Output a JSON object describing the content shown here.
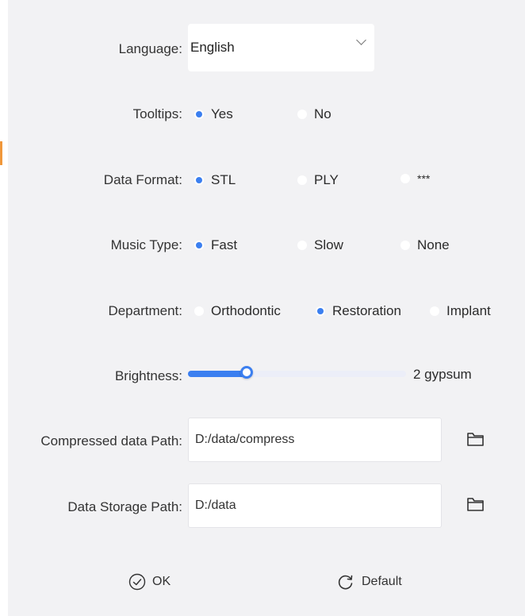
{
  "language": {
    "label": "Language:",
    "value": "English"
  },
  "tooltips": {
    "label": "Tooltips:",
    "options": [
      "Yes",
      "No"
    ],
    "selected": "Yes"
  },
  "data_format": {
    "label": "Data Format:",
    "options": [
      "STL",
      "PLY",
      "***"
    ],
    "selected": "STL"
  },
  "music_type": {
    "label": "Music Type:",
    "options": [
      "Fast",
      "Slow",
      "None"
    ],
    "selected": "Fast"
  },
  "department": {
    "label": "Department:",
    "options": [
      "Orthodontic",
      "Restoration",
      "Implant"
    ],
    "selected": "Restoration"
  },
  "brightness": {
    "label": "Brightness:",
    "level": 0.27,
    "value_text": "2 gypsum"
  },
  "compressed_path": {
    "label": "Compressed data Path:",
    "value": "D:/data/compress"
  },
  "storage_path": {
    "label": "Data Storage Path:",
    "value": "D:/data"
  },
  "buttons": {
    "ok": "OK",
    "default": "Default"
  },
  "colors": {
    "accent": "#3b7ff0",
    "panel_bg": "#f2f2f4",
    "edge_mark": "#f0973a"
  },
  "icons": {
    "folder": "folder-icon",
    "ok": "check-circle-icon",
    "default": "refresh-icon",
    "select": "chevron-down-icon"
  }
}
